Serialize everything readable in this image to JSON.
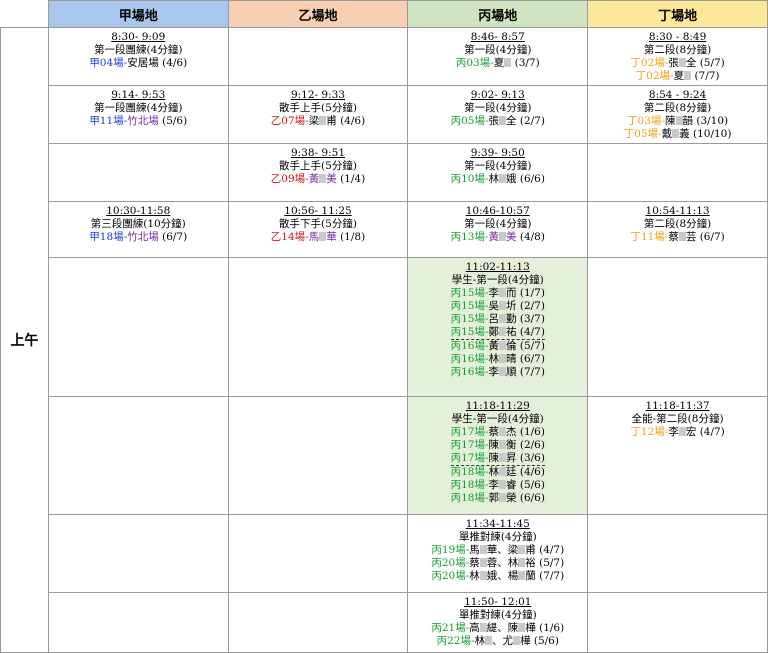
{
  "headers": [
    "甲場地",
    "乙場地",
    "丙場地",
    "丁場地"
  ],
  "side_label": "上午",
  "rows": [
    {
      "jia": {
        "time": "8:30- 9:09",
        "title": "第一段團練(4分鐘)",
        "entries": [
          {
            "court": "甲04場",
            "sep": "-",
            "name": "安居場",
            "extra": "",
            "count": "(4/6)"
          }
        ]
      },
      "yi": null,
      "bing": {
        "time": "8:46- 8:57",
        "title": "第一段(4分鐘)",
        "entries": [
          {
            "court": "丙03場",
            "sep": "-",
            "name": "夏",
            "extra": "",
            "count": "(3/7)"
          }
        ]
      },
      "ding": {
        "time": "8:30 - 8:49",
        "title": "第二段(8分鐘)",
        "entries": [
          {
            "court": "丁02場",
            "sep": "-",
            "name": "張",
            "extra": "全",
            "count": "(5/7)"
          },
          {
            "court": "丁02場",
            "sep": "-",
            "name": "夏",
            "extra": "",
            "count": "(7/7)"
          }
        ]
      }
    },
    {
      "jia": {
        "time": "9:14- 9:53",
        "title": "第一段團練(4分鐘)",
        "entries": [
          {
            "court": "甲11場",
            "sep": "-",
            "name": "竹北場",
            "extra": "",
            "count": "(5/6)"
          }
        ]
      },
      "yi": {
        "time": "9:12- 9:33",
        "title": "散手上手(5分鐘)",
        "entries": [
          {
            "court": "乙07場",
            "sep": "-",
            "name": "梁",
            "extra": "甫",
            "count": "(4/6)"
          }
        ]
      },
      "bing": {
        "time": "9:02- 9:13",
        "title": "第一段(4分鐘)",
        "entries": [
          {
            "court": "丙05場",
            "sep": "-",
            "name": "張",
            "extra": "全",
            "count": "(2/7)"
          }
        ]
      },
      "ding": {
        "time": "8:54 - 9:24",
        "title": "第二段(8分鐘)",
        "entries": [
          {
            "court": "丁03場",
            "sep": "-",
            "name": "陳",
            "extra": "韻",
            "count": "(3/10)"
          },
          {
            "court": "丁05場",
            "sep": "-",
            "name": "戴",
            "extra": "義",
            "count": "(10/10)"
          }
        ]
      }
    },
    {
      "jia": null,
      "yi": {
        "time": "9:38- 9:51",
        "title": "散手上手(5分鐘)",
        "entries": [
          {
            "court": "乙09場",
            "sep": "-",
            "name": "黃",
            "extra": "美",
            "count": "(1/4)"
          }
        ]
      },
      "bing": {
        "time": "9:39- 9:50",
        "title": "第一段(4分鐘)",
        "entries": [
          {
            "court": "丙10場",
            "sep": "-",
            "name": "林",
            "extra": "娥",
            "count": "(6/6)"
          }
        ]
      },
      "ding": null
    },
    {
      "jia": {
        "time": "10:30-11:58",
        "title": "第三段團練(10分鐘)",
        "entries": [
          {
            "court": "甲18場",
            "sep": "-",
            "name": "竹北場",
            "extra": "",
            "count": "(6/7)"
          }
        ]
      },
      "yi": {
        "time": "10:56- 11:25",
        "title": "散手下手(5分鐘)",
        "entries": [
          {
            "court": "乙14場",
            "sep": "-",
            "name": "馬",
            "extra": "華",
            "count": "(1/8)"
          }
        ]
      },
      "bing": {
        "time": "10:46-10:57",
        "title": "第一段(4分鐘)",
        "entries": [
          {
            "court": "丙13場",
            "sep": "-",
            "name": "黃",
            "extra": "美",
            "count": "(4/8)"
          }
        ]
      },
      "ding": {
        "time": "10:54-11:13",
        "title": "第二段(8分鐘)",
        "entries": [
          {
            "court": "丁11場",
            "sep": "-",
            "name": "蔡",
            "extra": "芸",
            "count": "(6/7)"
          }
        ]
      }
    },
    {
      "jia": null,
      "yi": null,
      "bing": {
        "time": "11:02-11:13",
        "title": "學生-第一段(4分鐘)",
        "entries": [
          {
            "court": "丙15場",
            "sep": "-",
            "name": "李",
            "extra": "而",
            "count": "(1/7)"
          },
          {
            "court": "丙15場",
            "sep": "-",
            "name": "吳",
            "extra": "圻",
            "count": "(2/7)"
          },
          {
            "court": "丙15場",
            "sep": "-",
            "name": "呂",
            "extra": "勤",
            "count": "(3/7)"
          },
          {
            "court": "丙15場",
            "sep": "-",
            "name": "鄭",
            "extra": "祐",
            "count": "(4/7)"
          },
          {
            "court": "丙16場",
            "sep": "-",
            "name": "黃",
            "extra": "倫",
            "count": "(5/7)"
          },
          {
            "court": "丙16場",
            "sep": "-",
            "name": "林",
            "extra": "晴",
            "count": "(6/7)"
          },
          {
            "court": "丙16場",
            "sep": "-",
            "name": "李",
            "extra": "順",
            "count": "(7/7)"
          }
        ]
      },
      "ding": null
    },
    {
      "jia": null,
      "yi": null,
      "bing": {
        "time": "11:18-11:29",
        "title": "學生-第一段(4分鐘)",
        "entries": [
          {
            "court": "丙17場",
            "sep": "-",
            "name": "蔡",
            "extra": "杰",
            "count": "(1/6)"
          },
          {
            "court": "丙17場",
            "sep": "-",
            "name": "陳",
            "extra": "衡",
            "count": "(2/6)"
          },
          {
            "court": "丙17場",
            "sep": "-",
            "name": "陳",
            "extra": "昇",
            "count": "(3/6)"
          },
          {
            "court": "丙18場",
            "sep": "-",
            "name": "林",
            "extra": "廷",
            "count": "(4/6)"
          },
          {
            "court": "丙18場",
            "sep": "-",
            "name": "李",
            "extra": "睿",
            "count": "(5/6)"
          },
          {
            "court": "丙18場",
            "sep": "-",
            "name": "郭",
            "extra": "榮",
            "count": "(6/6)"
          }
        ]
      },
      "ding": {
        "time": "11:18-11:37",
        "title": "全能-第二段(8分鐘)",
        "entries": [
          {
            "court": "丁12場",
            "sep": "-",
            "name": "李",
            "extra": "宏",
            "count": "(4/7)"
          }
        ]
      }
    },
    {
      "jia": null,
      "yi": null,
      "bing": {
        "time": "11:34-11:45",
        "title": "單推對練(4分鐘)",
        "entries": [
          {
            "court": "丙19場",
            "sep": "-",
            "name": "馬",
            "extra": "華、梁",
            "tail": "甫",
            "count": "(4/7)"
          },
          {
            "court": "丙20場",
            "sep": "-",
            "name": "蔡",
            "extra": "蓉、林",
            "tail": "裕",
            "count": "(5/7)"
          },
          {
            "court": "丙20場",
            "sep": "-",
            "name": "林",
            "extra": "娥、楊",
            "tail": "蘭",
            "count": "(7/7)"
          }
        ]
      },
      "ding": null
    },
    {
      "jia": null,
      "yi": null,
      "bing": {
        "time": "11:50- 12:01",
        "title": "單推對練(4分鐘)",
        "entries": [
          {
            "court": "丙21場",
            "sep": "-",
            "name": "高",
            "extra": "緹、陳",
            "tail": "樺",
            "count": "(1/6)"
          },
          {
            "court": "丙22場",
            "sep": "-",
            "name": "林",
            "extra": "、尤",
            "tail": "樺",
            "count": "(5/6)"
          }
        ]
      },
      "ding": null
    }
  ],
  "colors": {
    "jia": "#1d3be0",
    "yi": "#d31515",
    "bing": "#14a035",
    "ding": "#f0a010",
    "name": "#7a2ba8"
  }
}
